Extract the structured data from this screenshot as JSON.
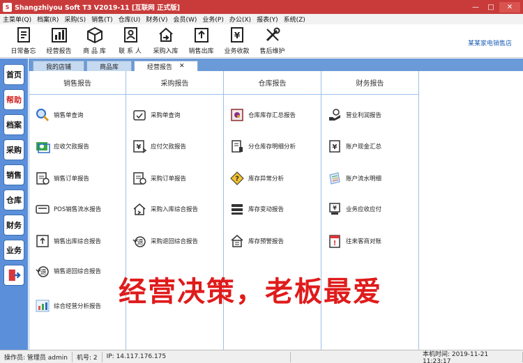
{
  "window": {
    "title": "Shangzhiyou Soft T3 V2019-11 [互联网 正式版]",
    "app_icon": "app-logo-icon"
  },
  "menu": [
    "主菜单(Q)",
    "档案(R)",
    "采购(S)",
    "销售(T)",
    "仓库(U)",
    "财务(V)",
    "会员(W)",
    "业务(P)",
    "办公(X)",
    "报表(Y)",
    "系统(Z)"
  ],
  "toolbar": {
    "buttons": [
      {
        "label": "日常备忘",
        "icon": "memo-icon"
      },
      {
        "label": "经营报告",
        "icon": "bar-chart-icon"
      },
      {
        "label": "商 品 库",
        "icon": "box-icon"
      },
      {
        "label": "联 系 人",
        "icon": "contacts-icon"
      },
      {
        "label": "采购入库",
        "icon": "house-in-icon"
      },
      {
        "label": "销售出库",
        "icon": "upload-icon"
      },
      {
        "label": "业务收款",
        "icon": "yen-doc-icon"
      },
      {
        "label": "售后维护",
        "icon": "tools-icon"
      }
    ],
    "store_name": "某某家电销售店"
  },
  "leftnav": [
    "首页",
    "帮助",
    "档案",
    "采购",
    "销售",
    "仓库",
    "财务",
    "业务"
  ],
  "tabs": [
    "我的店铺",
    "商品库",
    "经营报告"
  ],
  "columns": [
    {
      "header": "销售报告",
      "items": [
        "销售单查询",
        "应收欠款报告",
        "销售订单报告",
        "POS销售流水报告",
        "销售出库综合报告",
        "销售退回综合报告",
        "综合经营分析报告"
      ]
    },
    {
      "header": "采购报告",
      "items": [
        "采购单查询",
        "应付欠款报告",
        "采购订单报告",
        "采购入库综合报告",
        "采购退回综合报告"
      ]
    },
    {
      "header": "仓库报告",
      "items": [
        "仓库库存汇总报告",
        "分仓库存明细分析",
        "库存异常分析",
        "库存变动报告",
        "库存预警报告"
      ]
    },
    {
      "header": "财务报告",
      "items": [
        "营业利润报告",
        "账户现金汇总",
        "账户流水明细",
        "业务应收应付",
        "往来客商对账"
      ]
    }
  ],
  "slogan": "经营决策，老板最爱",
  "status": {
    "operator": "操作员: 管理员 admin",
    "machine": "机号: 2",
    "ip": "IP: 14.117.176.175",
    "time": "本机时间: 2019-11-21 11:23:17"
  }
}
